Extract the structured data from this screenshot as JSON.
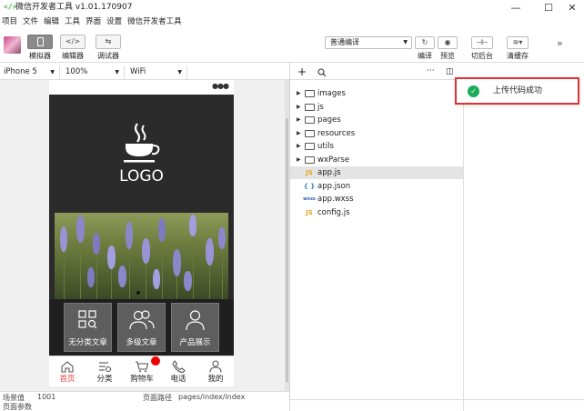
{
  "window": {
    "title": "微信开发者工具 v1.01.170907",
    "icon": "code-brackets-icon",
    "controls": [
      "minimize",
      "maximize",
      "close"
    ]
  },
  "menu": [
    "项目",
    "文件",
    "编辑",
    "工具",
    "界面",
    "设置",
    "微信开发者工具"
  ],
  "toolbar": {
    "simulator_label": "模拟器",
    "editor_label": "编辑器",
    "debugger_label": "调试器",
    "compile_mode": "普通编译",
    "compile_label": "编译",
    "preview_label": "预览",
    "background_label": "切后台",
    "clear_cache_label": "清缓存"
  },
  "device": {
    "model": "iPhone 5",
    "zoom": "100%",
    "network": "WiFi"
  },
  "phone": {
    "logo_text": "LOGO",
    "categories": [
      {
        "label": "无分类文章",
        "icon": "grid-search-icon"
      },
      {
        "label": "多级文章",
        "icon": "users-icon"
      },
      {
        "label": "产品展示",
        "icon": "user-icon"
      }
    ],
    "tabs": [
      {
        "label": "首页",
        "icon": "home-icon"
      },
      {
        "label": "分类",
        "icon": "category-icon"
      },
      {
        "label": "购物车",
        "icon": "cart-icon"
      },
      {
        "label": "电话",
        "icon": "phone-icon"
      },
      {
        "label": "我的",
        "icon": "person-icon"
      }
    ],
    "active_tab": "首页",
    "accent": "#e64340",
    "badge_color": "#ee0000"
  },
  "status": {
    "scene_label": "场景值",
    "scene_value": "1001",
    "path_label": "页面路径",
    "path_value": "pages/index/index",
    "params_label": "页面参数"
  },
  "files": {
    "toolbar": [
      "add-icon",
      "search-icon",
      "more-icon",
      "split-icon"
    ],
    "items": [
      {
        "name": "images",
        "type": "folder"
      },
      {
        "name": "js",
        "type": "folder"
      },
      {
        "name": "pages",
        "type": "folder"
      },
      {
        "name": "resources",
        "type": "folder"
      },
      {
        "name": "utils",
        "type": "folder"
      },
      {
        "name": "wxParse",
        "type": "folder"
      },
      {
        "name": "app.js",
        "type": "js",
        "tag": "JS"
      },
      {
        "name": "app.json",
        "type": "json",
        "tag": "{ }"
      },
      {
        "name": "app.wxss",
        "type": "wxss",
        "tag": "wxss"
      },
      {
        "name": "config.js",
        "type": "js",
        "tag": "JS"
      }
    ],
    "selected": "app.js"
  },
  "toast": {
    "text": "上传代码成功",
    "icon": "check-circle-icon",
    "color": "#1aad5a",
    "border_color": "#dd3333"
  }
}
